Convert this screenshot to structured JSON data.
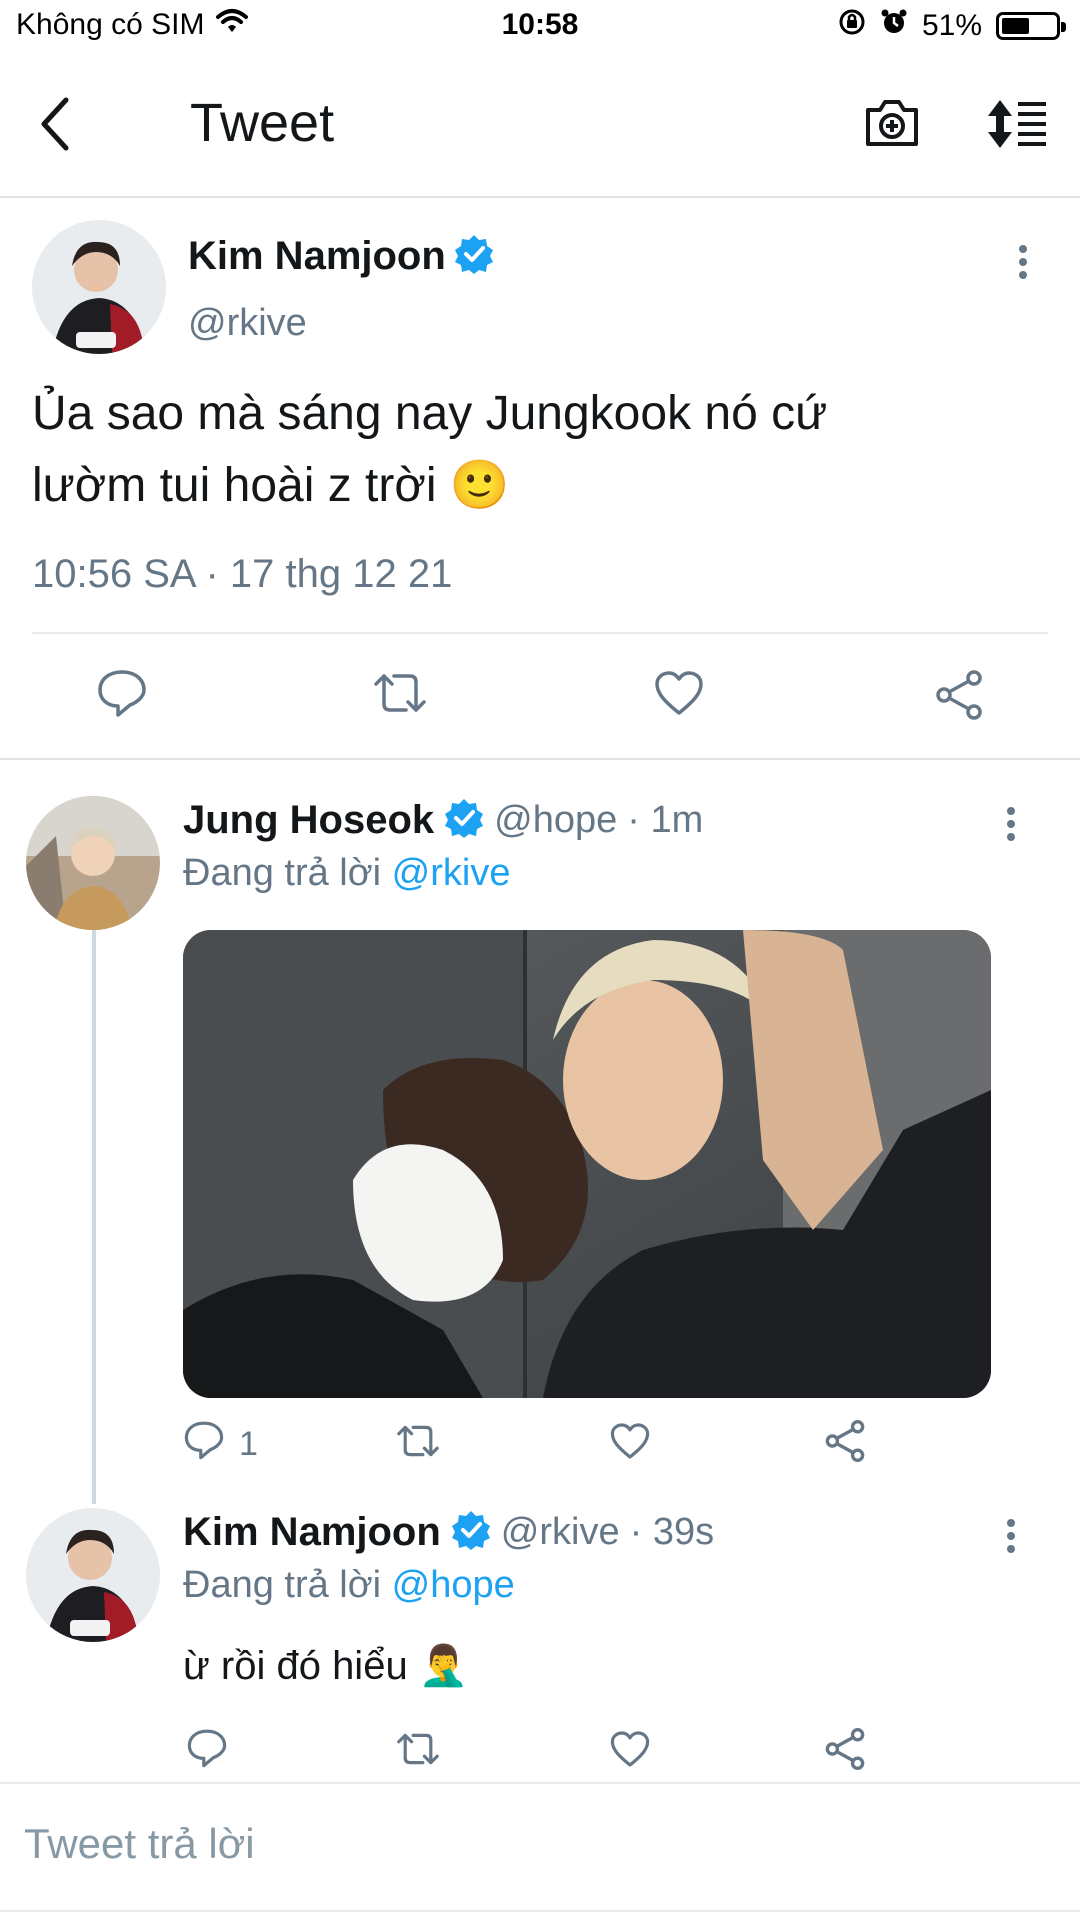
{
  "status_bar": {
    "carrier": "Không có SIM",
    "time": "10:58",
    "battery": "51%",
    "battery_level": 0.51
  },
  "header": {
    "title": "Tweet",
    "icons": [
      "back-arrow-icon",
      "camera-plus-icon",
      "sort-timeline-icon"
    ]
  },
  "main_tweet": {
    "author_name": "Kim Namjoon",
    "author_handle": "@rkive",
    "text_line1": "Ủa sao mà sáng nay Jungkook nó cứ",
    "text_line2": "lườm tui hoài z trời 🙂",
    "timestamp": "10:56 SA · 17 thg 12 21",
    "actions": [
      "reply-icon",
      "retweet-icon",
      "like-icon",
      "share-icon"
    ]
  },
  "replies": [
    {
      "author_name": "Jung Hoseok",
      "author_handle": "@hope",
      "time": "· 1m",
      "replying_label": "Đang trả lời",
      "replying_to": "@rkive",
      "reply_count": "1",
      "has_photo": true
    },
    {
      "author_name": "Kim Namjoon",
      "author_handle": "@rkive",
      "time": "· 39s",
      "replying_label": "Đang trả lời",
      "replying_to": "@hope",
      "text": "ừ rồi đó hiểu 🤦‍♂️"
    }
  ],
  "compose": {
    "placeholder": "Tweet trả lời"
  },
  "colors": {
    "accent": "#1da1f2",
    "text_primary": "#14171a",
    "text_secondary": "#657786",
    "divider": "#e6ecf0"
  }
}
